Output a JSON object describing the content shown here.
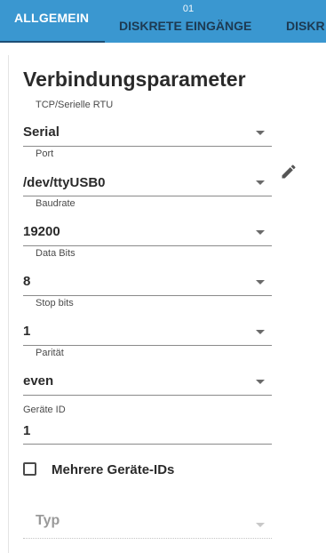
{
  "tabs": [
    {
      "label": "ALLGEMEIN",
      "badge": ""
    },
    {
      "label": "DISKRETE EINGÄNGE",
      "badge": "01"
    },
    {
      "label": "DISKR"
    }
  ],
  "section": {
    "title": "Verbindungsparameter"
  },
  "fields": {
    "connection_type": {
      "label": "TCP/Serielle RTU",
      "value": "Serial"
    },
    "port": {
      "label": "Port",
      "value": "/dev/ttyUSB0"
    },
    "baudrate": {
      "label": "Baudrate",
      "value": "19200"
    },
    "data_bits": {
      "label": "Data Bits",
      "value": "8"
    },
    "stop_bits": {
      "label": "Stop bits",
      "value": "1"
    },
    "parity": {
      "label": "Parität",
      "value": "even"
    },
    "device_id": {
      "label": "Geräte ID",
      "value": "1"
    }
  },
  "checkbox": {
    "label": "Mehrere Geräte-IDs",
    "checked": false
  },
  "typ": {
    "placeholder": "Typ"
  },
  "icons": {
    "edit": "pencil-icon",
    "dropdown": "chevron-down-icon"
  },
  "colors": {
    "tabbar": "#3a97d0",
    "active_indicator": "#1d4f75"
  }
}
